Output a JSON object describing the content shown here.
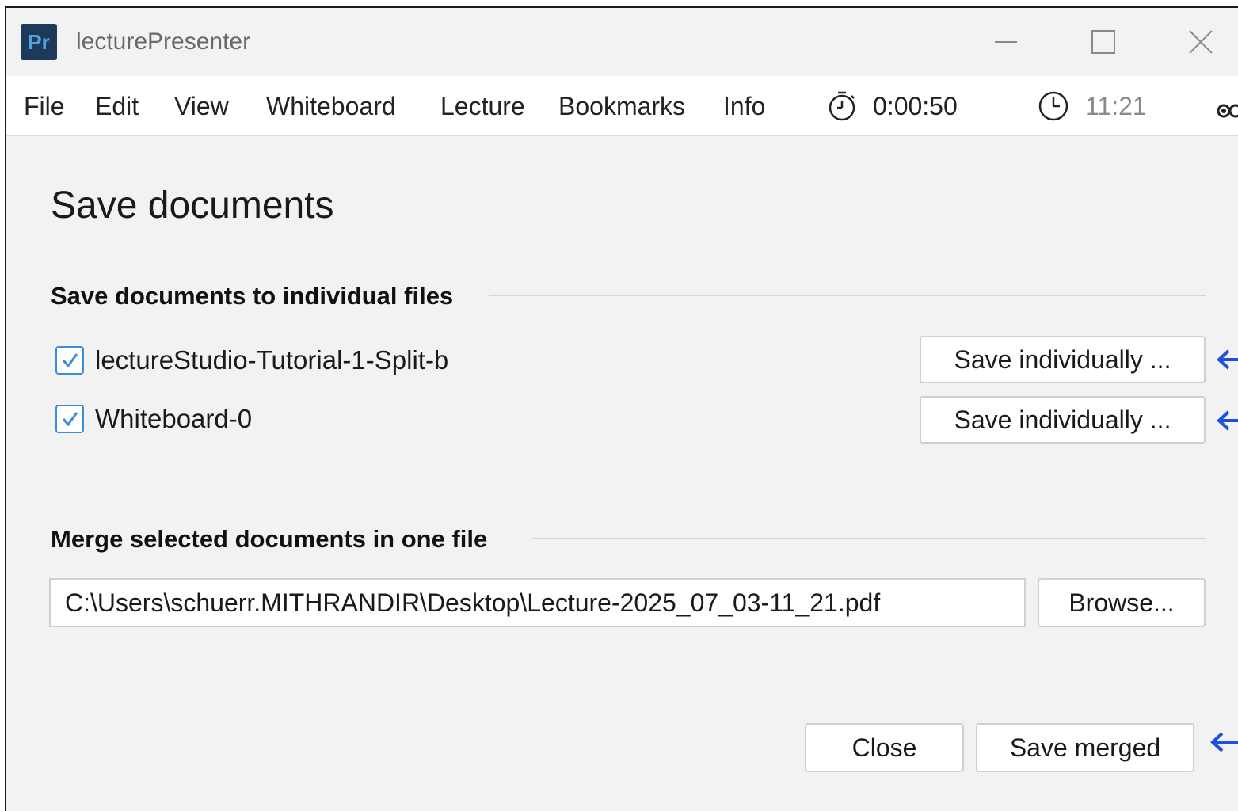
{
  "window": {
    "title": "lecturePresenter",
    "app_icon_text": "Pr"
  },
  "menu": {
    "items": [
      "File",
      "Edit",
      "View",
      "Whiteboard",
      "Lecture",
      "Bookmarks",
      "Info"
    ],
    "stopwatch": "0:00:50",
    "clock": "11:21"
  },
  "dialog": {
    "title": "Save documents",
    "individual_section": "Save documents to individual files",
    "documents": [
      {
        "name": "lectureStudio-Tutorial-1-Split-b",
        "checked": true,
        "button": "Save individually ..."
      },
      {
        "name": "Whiteboard-0",
        "checked": true,
        "button": "Save individually ..."
      }
    ],
    "merge_section": "Merge selected documents in one file",
    "merge_path": "C:\\Users\\schuerr.MITHRANDIR\\Desktop\\Lecture-2025_07_03-11_21.pdf",
    "browse_label": "Browse...",
    "close_label": "Close",
    "save_merged_label": "Save merged"
  },
  "colors": {
    "accent": "#3d8ed8",
    "annotation_arrow": "#1f4fe0",
    "background": "#f2f2f2"
  },
  "icons": [
    "app-icon",
    "minimize-icon",
    "maximize-icon",
    "close-icon",
    "stopwatch-icon",
    "clock-icon",
    "checkmark-icon",
    "arrow-left-icon"
  ]
}
